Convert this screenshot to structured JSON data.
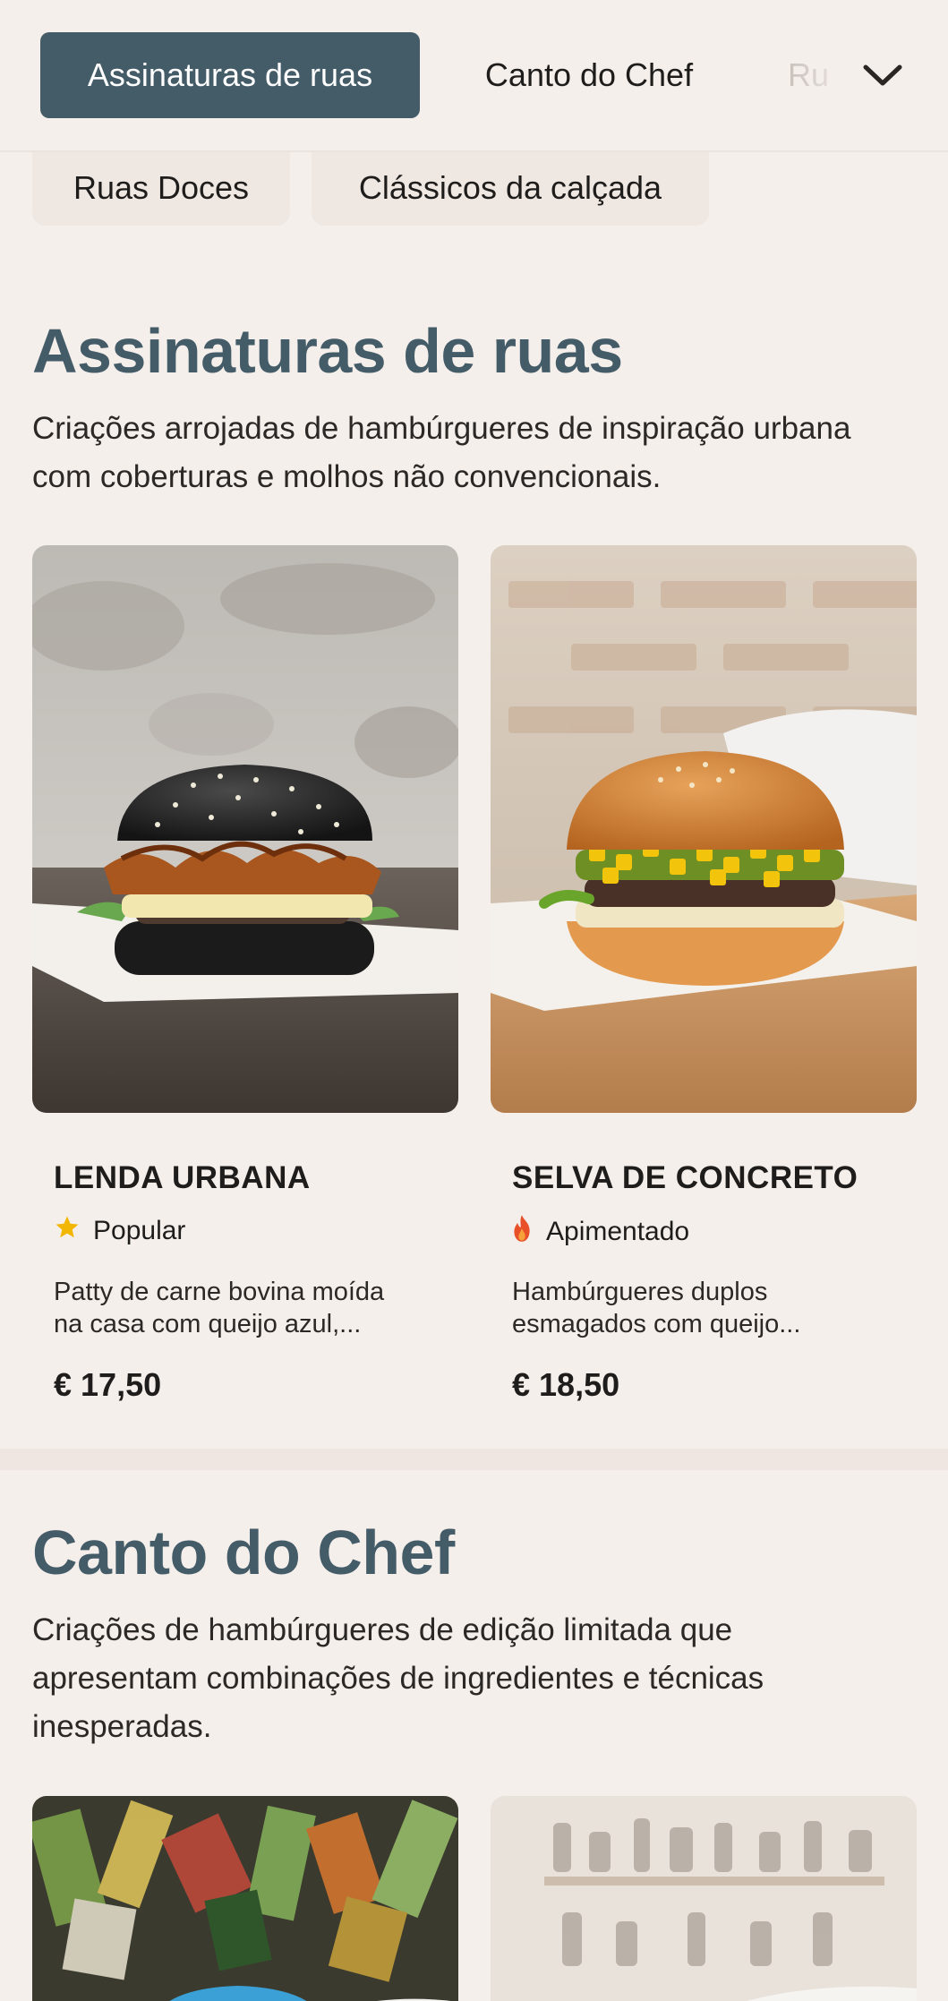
{
  "nav": {
    "tabs": [
      {
        "label": "Assinaturas de ruas",
        "active": true
      },
      {
        "label": "Canto do Chef",
        "active": false
      },
      {
        "label": "Ru",
        "active": false
      }
    ],
    "chips": [
      "Ruas Doces",
      "Clássicos da calçada"
    ],
    "expand_icon": "chevron-down-icon"
  },
  "sections": [
    {
      "title": "Assinaturas de ruas",
      "description": "Criações arrojadas de hambúrgueres de inspiração urbana com coberturas e molhos não convencionais.",
      "items": [
        {
          "name": "LENDA URBANA",
          "badge": "Popular",
          "badge_icon": "star-icon",
          "description_line1": "Patty de carne bovina moída",
          "description_line2": "na casa com queijo azul,...",
          "price": "€ 17,50"
        },
        {
          "name": "SELVA DE CONCRETO",
          "badge": "Apimentado",
          "badge_icon": "flame-icon",
          "description_line1": "Hambúrgueres duplos",
          "description_line2": "esmagados com queijo...",
          "price": "€ 18,50"
        }
      ]
    },
    {
      "title": "Canto do Chef",
      "description_line1": "Criações de hambúrgueres de edição limitada que",
      "description_line2": "apresentam combinações de ingredientes e técnicas",
      "description_line3": "inesperadas."
    }
  ],
  "colors": {
    "background": "#f5efeb",
    "accent": "#445b68",
    "star": "#f2b705",
    "flame": "#e8502a"
  }
}
